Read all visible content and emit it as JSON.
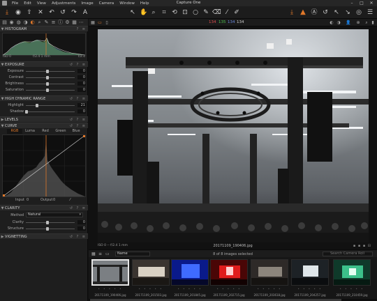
{
  "window": {
    "title": "Capture One",
    "menu": [
      "File",
      "Edit",
      "View",
      "Adjustments",
      "Image",
      "Camera",
      "Window",
      "Help"
    ]
  },
  "toolbar": {
    "left_icons": [
      "import-icon",
      "capture-icon",
      "export-icon",
      "delete-icon",
      "undo-icon",
      "undo-all-icon",
      "redo-icon",
      "text-icon"
    ],
    "cursor_tools": [
      "select-icon",
      "pan-icon",
      "loupe-icon",
      "crop-icon",
      "straighten-icon",
      "keystone-icon",
      "spot-icon",
      "brush-icon",
      "eraser-icon",
      "picker-icon",
      "annotate-icon"
    ],
    "right_icons": [
      "process-icon",
      "warning-icon",
      "auto-adjust-icon",
      "reset-icon",
      "copy-adjust-icon",
      "apply-adjust-icon",
      "view-icon",
      "adjustments-icon"
    ]
  },
  "tool_tabs": [
    "library-icon",
    "capture-tab-icon",
    "lens-icon",
    "color-icon",
    "exposure-tab-icon",
    "details-icon",
    "local-icon",
    "adjust-icon",
    "metadata-icon",
    "output-icon",
    "batch-icon",
    "settings-icon"
  ],
  "histogram": {
    "title": "HISTOGRAM",
    "iso": "ISO 0",
    "ev": "f/2.4 1 mm",
    "ev_right": "f/2.4"
  },
  "exposure": {
    "title": "EXPOSURE",
    "rows": [
      {
        "label": "Exposure",
        "value": "0"
      },
      {
        "label": "Contrast",
        "value": "0"
      },
      {
        "label": "Brightness",
        "value": "0"
      },
      {
        "label": "Saturation",
        "value": "0"
      }
    ]
  },
  "hdr": {
    "title": "HIGH DYNAMIC RANGE",
    "rows": [
      {
        "label": "Highlight",
        "value": "21"
      },
      {
        "label": "Shadow",
        "value": "0"
      }
    ]
  },
  "levels": {
    "title": "LEVELS"
  },
  "curve": {
    "title": "CURVE",
    "tabs": [
      "RGB",
      "Luma",
      "Red",
      "Green",
      "Blue"
    ],
    "input_label": "Input",
    "input_value": "0",
    "output_label": "Output",
    "output_value": "0"
  },
  "clarity": {
    "title": "CLARITY",
    "method_label": "Method",
    "method_value": "Natural",
    "rows": [
      {
        "label": "Clarity",
        "value": "0"
      },
      {
        "label": "Structure",
        "value": "0"
      }
    ]
  },
  "vignetting": {
    "title": "VIGNETTING"
  },
  "viewer": {
    "rgb_r": "134",
    "rgb_g": "135",
    "rgb_b": "134",
    "exif": "ISO 0 -- f/2.4 1 mm",
    "filename": "20171109_190406.jpg"
  },
  "browser": {
    "sort_label": "Name",
    "count_text": "8 of 8 images selected",
    "search_placeholder": "Search Camera Roll",
    "thumbnails": [
      {
        "name": "20171109_190406.jpg",
        "selected": true
      },
      {
        "name": "20171109_201503.jpg",
        "selected": false
      },
      {
        "name": "20171109_201845.jpg",
        "selected": false
      },
      {
        "name": "20171109_202715.jpg",
        "selected": false
      },
      {
        "name": "20171109_203618.jpg",
        "selected": false
      },
      {
        "name": "20171109_204257.jpg",
        "selected": false
      },
      {
        "name": "20171109_210459.jpg",
        "selected": false
      }
    ]
  },
  "colors": {
    "accent": "#e0782a",
    "panel_bg": "#1e1e1e",
    "header_bg": "#2a2a2a"
  }
}
